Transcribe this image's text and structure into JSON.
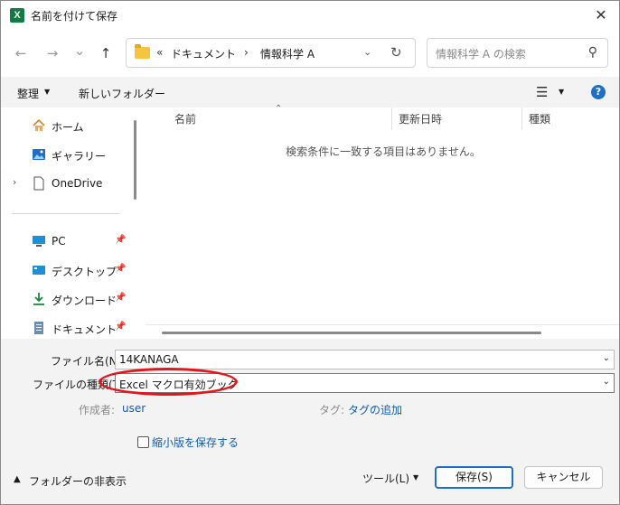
{
  "window": {
    "title": "名前を付けて保存",
    "app_icon": "X",
    "close": "✕"
  },
  "nav": {
    "back": "←",
    "forward": "→",
    "recent": "⌄",
    "up": "↑",
    "address": {
      "prefix": "«",
      "items": [
        "ドキュメント",
        "情報科学 A"
      ],
      "separator": "›"
    },
    "search_placeholder": "情報科学 A の検索"
  },
  "toolbar": {
    "organize": "整理",
    "new_folder": "新しいフォルダー"
  },
  "sidebar": {
    "items": [
      {
        "label": "ホーム",
        "icon": "home-icon"
      },
      {
        "label": "ギャラリー",
        "icon": "gallery-icon"
      },
      {
        "label": "OneDrive",
        "icon": "file-icon",
        "expander": "›"
      },
      {
        "label": "PC",
        "icon": "pc-icon",
        "pinned": true
      },
      {
        "label": "デスクトップ",
        "icon": "desktop-icon",
        "pinned": true
      },
      {
        "label": "ダウンロード",
        "icon": "download-icon",
        "pinned": true
      },
      {
        "label": "ドキュメント",
        "icon": "document-icon",
        "pinned": true
      }
    ]
  },
  "filelist": {
    "columns": [
      "名前",
      "更新日時",
      "種類"
    ],
    "empty_message": "検索条件に一致する項目はありません。"
  },
  "form": {
    "filename_label": "ファイル名(N):",
    "filename_value": "14KANAGA",
    "filetype_label": "ファイルの種類(T):",
    "filetype_label_visible": "ファイルの種類",
    "filetype_value": "Excel マクロ有効ブック",
    "author_label": "作成者:",
    "author_value": "user",
    "tags_label": "タグ:",
    "tags_value": "タグの追加",
    "thumbnail_label": "縮小版を保存する"
  },
  "footer": {
    "hide_folders": "フォルダーの非表示",
    "tools": "ツール(L)",
    "save": "保存(S)",
    "cancel": "キャンセル"
  },
  "colors": {
    "accent": "#1f6fc8",
    "annotation": "#e3161c",
    "excel": "#107c41"
  }
}
